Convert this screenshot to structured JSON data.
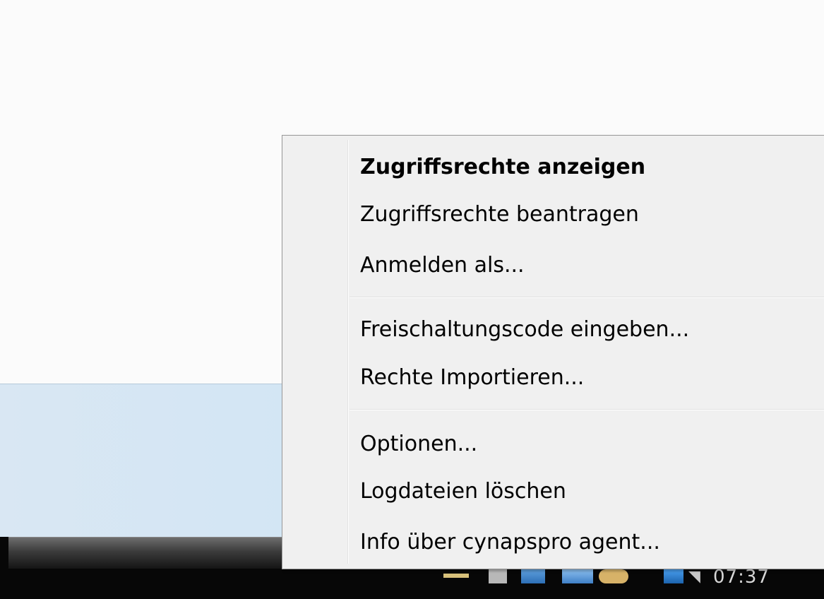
{
  "context_menu": {
    "groups": [
      {
        "items": [
          {
            "label": "Zugriffsrechte anzeigen",
            "default": true
          },
          {
            "label": "Zugriffsrechte beantragen",
            "default": false
          },
          {
            "label": "Anmelden als...",
            "default": false
          }
        ]
      },
      {
        "items": [
          {
            "label": "Freischaltungscode eingeben...",
            "default": false
          },
          {
            "label": "Rechte Importieren...",
            "default": false
          }
        ]
      },
      {
        "items": [
          {
            "label": "Optionen...",
            "default": false
          },
          {
            "label": "Logdateien löschen",
            "default": false
          },
          {
            "label": "Info über cynapspro agent...",
            "default": false
          }
        ]
      }
    ]
  },
  "taskbar": {
    "clock": "07:37"
  }
}
